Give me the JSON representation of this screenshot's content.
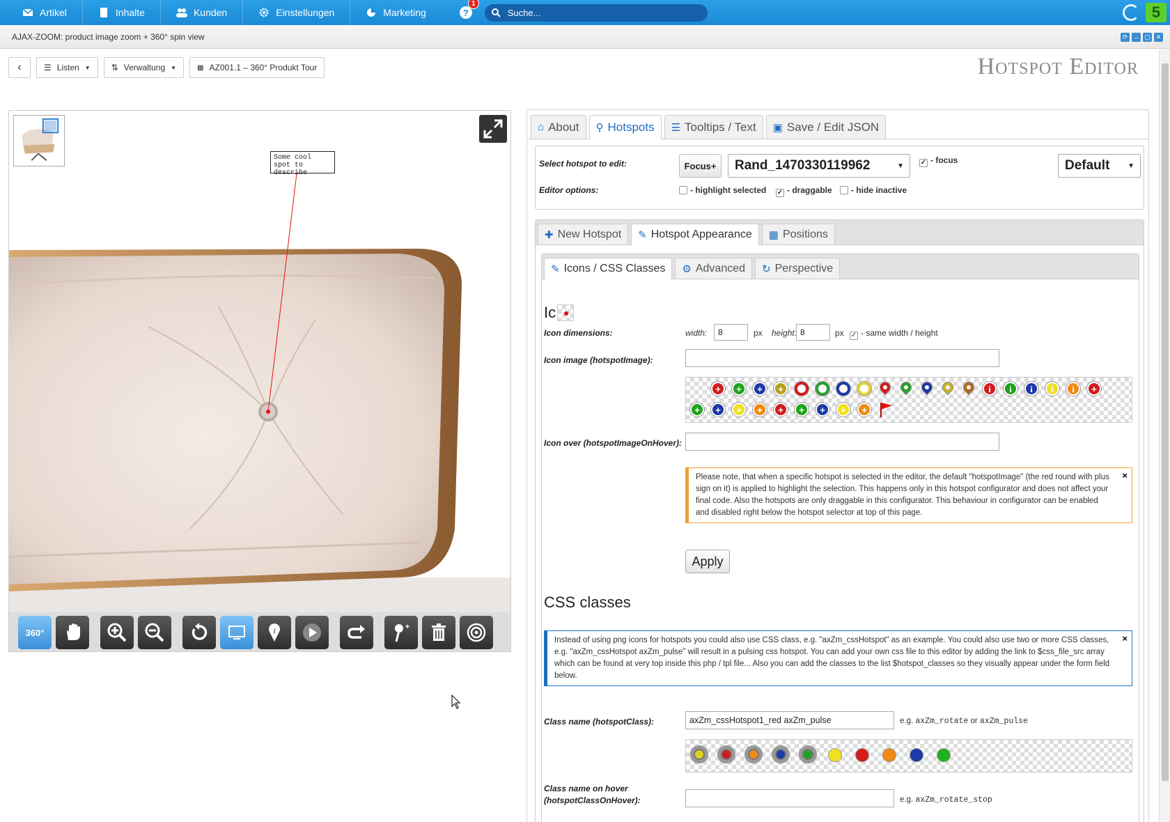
{
  "nav": {
    "items": [
      {
        "label": "Artikel",
        "icon": "envelope-icon"
      },
      {
        "label": "Inhalte",
        "icon": "document-icon"
      },
      {
        "label": "Kunden",
        "icon": "users-icon"
      },
      {
        "label": "Einstellungen",
        "icon": "gear-icon"
      },
      {
        "label": "Marketing",
        "icon": "pie-chart-icon"
      }
    ],
    "help_badge": "1",
    "search_placeholder": "Suche..."
  },
  "window": {
    "title": "AJAX-ZOOM: product image zoom + 360° spin view"
  },
  "toolbar": {
    "back_icon": "chevron-left-icon",
    "lists_label": "Listen",
    "management_label": "Verwaltung",
    "product_label": "AZ001.1 – 360° Produkt Tour",
    "editor_title": "Hotspot Editor"
  },
  "viewer": {
    "tooltip_text": "Some cool spot to describe",
    "controls": [
      "360°",
      "pan",
      "zoom-in",
      "zoom-out",
      "reset",
      "gallery",
      "hotspot",
      "play",
      "rotate",
      "add-hotspot",
      "delete",
      "spin-target"
    ]
  },
  "main_tabs": [
    {
      "label": "About",
      "icon": "home-icon",
      "active": false
    },
    {
      "label": "Hotspots",
      "icon": "map-marker-icon",
      "active": true
    },
    {
      "label": "Tooltips / Text",
      "icon": "list-icon",
      "active": false
    },
    {
      "label": "Save / Edit JSON",
      "icon": "floppy-icon",
      "active": false
    }
  ],
  "selector": {
    "select_label": "Select hotspot to edit:",
    "focus_button": "Focus+",
    "selected_hotspot": "Rand_1470330119962",
    "focus_label": "- focus",
    "focus_checked": true,
    "preset_value": "Default",
    "editor_options_label": "Editor options:",
    "opt_highlight": "- highlight selected",
    "opt_highlight_checked": false,
    "opt_draggable": "- draggable",
    "opt_draggable_checked": true,
    "opt_hide_inactive": "- hide inactive",
    "opt_hide_inactive_checked": false
  },
  "appearance_tabs": [
    {
      "label": "New Hotspot",
      "icon": "plus-icon",
      "active": false
    },
    {
      "label": "Hotspot Appearance",
      "icon": "paint-icon",
      "active": true
    },
    {
      "label": "Positions",
      "icon": "grid-icon",
      "active": false
    }
  ],
  "icon_tabs": [
    {
      "label": "Icons / CSS Classes",
      "icon": "paint-icon",
      "active": true
    },
    {
      "label": "Advanced",
      "icon": "gear-icon",
      "active": false
    },
    {
      "label": "Perspective",
      "icon": "refresh-icon",
      "active": false
    }
  ],
  "icons_section": {
    "heading": "Ic",
    "dimensions_label": "Icon dimensions:",
    "width_label": "width:",
    "width_value": "8",
    "height_label": "height:",
    "height_value": "8",
    "px_unit": "px",
    "same_label": "- same width / height",
    "same_checked": true,
    "image_label": "Icon image (hotspotImage):",
    "image_value": "",
    "over_label": "Icon over (hotspotImageOnHover):",
    "over_value": "",
    "note": "Please note, that when a specific hotspot is selected in the editor, the default \"hotspotImage\" (the red round with plus sign on it) is applied to highlight the selection. This happens only in this hotspot configurator and does not affect your final code. Also the hotspots are only draggable in this configurator. This behaviour in configurator can be enabled and disabled right below the hotspot selector at top of this page.",
    "apply_label": "Apply",
    "note_close": "×"
  },
  "css_section": {
    "heading": "CSS classes",
    "note": "Instead of using png icons for hotspots you could also use CSS class, e.g. \"axZm_cssHotspot\" as an example. You could also use two or more CSS classes, e.g. \"axZm_cssHotspot axZm_pulse\" will result in a pulsing css hotspot. You can add your own css file to this editor by adding the link to $css_file_src array which can be found at very top inside this php / tpl file... Also you can add the classes to the list $hotspot_classes so they visually appear under the form field below.",
    "class_label": "Class name (hotspotClass):",
    "class_value": "axZm_cssHotspot1_red axZm_pulse",
    "class_hint_prefix": "e.g.",
    "class_hint_a": "axZm_rotate",
    "class_hint_or": "or",
    "class_hint_b": "axZm_pulse",
    "hover_label_1": "Class name on hover",
    "hover_label_2": "(hotspotClassOnHover):",
    "hover_value": "",
    "hover_hint_prefix": "e.g.",
    "hover_hint": "axZm_rotate_stop"
  },
  "colors": {
    "nav_blue": "#1a8ad6",
    "accent_blue": "#1d6fc2",
    "warning_border": "#f0a030",
    "info_border": "#1d6fc2"
  }
}
